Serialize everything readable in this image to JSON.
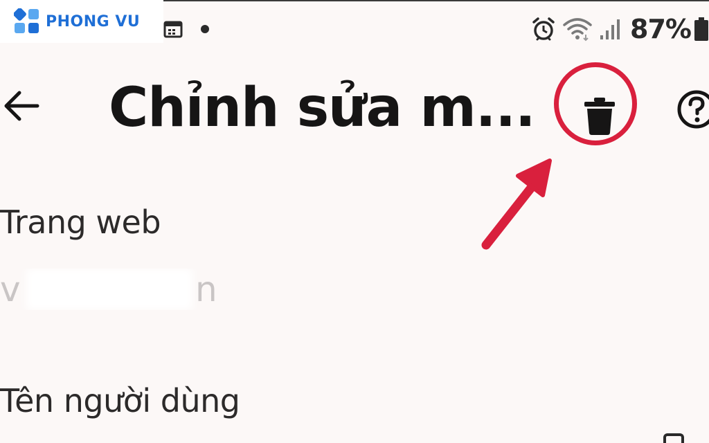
{
  "watermark": {
    "brand_name": "PHONG VU",
    "brand_color": "#1f6fd6"
  },
  "status_bar": {
    "battery_percent_text": "87%",
    "icons": [
      "calendar-icon",
      "notification-dot-icon",
      "alarm-icon",
      "wifi-icon",
      "signal-icon",
      "battery-icon"
    ]
  },
  "app_bar": {
    "title": "Chỉnh sửa m...",
    "back_icon": "arrow-left-icon",
    "delete_icon": "trash-icon",
    "help_icon": "help-circle-icon"
  },
  "form": {
    "website_label": "Trang web",
    "website_value_start": "v",
    "website_value_end": "n",
    "username_label": "Tên người dùng"
  },
  "annotation": {
    "highlight_color": "#d9203d",
    "target": "trash-icon"
  }
}
